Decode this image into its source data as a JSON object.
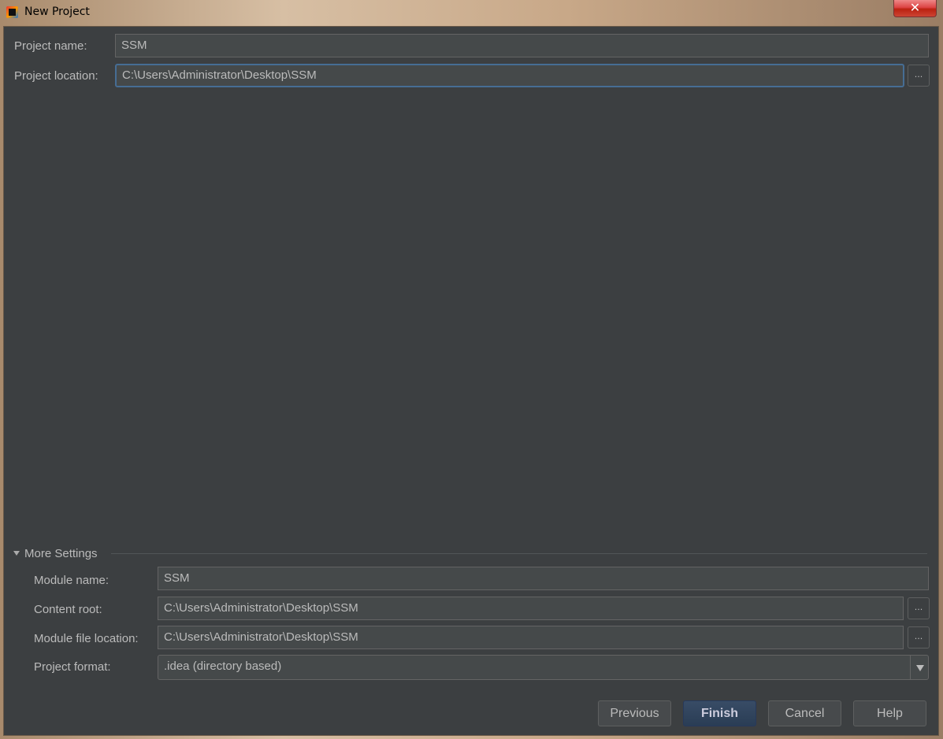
{
  "window": {
    "title": "New Project",
    "close_icon": "close-icon",
    "app_icon": "intellij-idea-icon"
  },
  "form": {
    "project_name_label": "Project name:",
    "project_name": "SSM",
    "project_location_label": "Project location:",
    "project_location": "C:\\Users\\Administrator\\Desktop\\SSM",
    "browse_label": "..."
  },
  "more_settings": {
    "title": "More Settings",
    "expanded": true,
    "module_name_label": "Module name:",
    "module_name": "SSM",
    "content_root_label": "Content root:",
    "content_root": "C:\\Users\\Administrator\\Desktop\\SSM",
    "module_file_location_label": "Module file location:",
    "module_file_location": "C:\\Users\\Administrator\\Desktop\\SSM",
    "project_format_label": "Project format:",
    "project_format": ".idea (directory based)"
  },
  "buttons": {
    "previous": "Previous",
    "finish": "Finish",
    "cancel": "Cancel",
    "help": "Help"
  }
}
